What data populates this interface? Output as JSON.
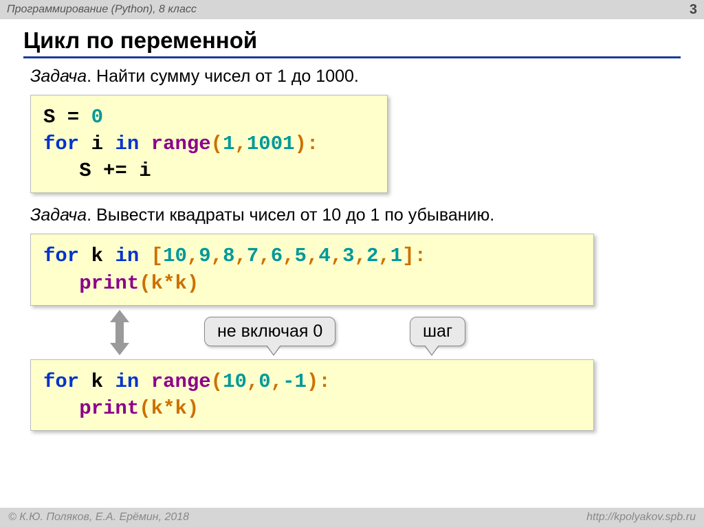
{
  "header": {
    "course": "Программирование (Python), 8 класс",
    "page": "3"
  },
  "title": "Цикл по переменной",
  "task1_label": "Задача",
  "task1_text": ". Найти сумму чисел от 1 до 1000.",
  "code1": {
    "l1a": "S = ",
    "l1b": "0",
    "l2a": "for",
    "l2b": " i ",
    "l2c": "in",
    "l2d": " range",
    "l2e": "(",
    "l2f": "1",
    "l2g": ",",
    "l2h": "1001",
    "l2i": "):",
    "l3": "   S += i"
  },
  "task2_label": "Задача",
  "task2_text": ". Вывести квадраты чисел от 10 до 1 по убыванию.",
  "code2": {
    "l1a": "for",
    "l1b": " k ",
    "l1c": "in",
    "l1d": " ",
    "l1e": "[",
    "l1f": "10",
    "l1g": ",",
    "l1h": "9",
    "l1i": ",",
    "l1j": "8",
    "l1k": ",",
    "l1l": "7",
    "l1m": ",",
    "l1n": "6",
    "l1o": ",",
    "l1p": "5",
    "l1q": ",",
    "l1r": "4",
    "l1s": ",",
    "l1t": "3",
    "l1u": ",",
    "l1v": "2",
    "l1w": ",",
    "l1x": "1",
    "l1y": "]:",
    "l2a": "   print",
    "l2b": "(k*k)"
  },
  "callout1": "не включая 0",
  "callout2": "шаг",
  "code3": {
    "l1a": "for",
    "l1b": " k ",
    "l1c": "in",
    "l1d": " range",
    "l1e": "(",
    "l1f": "10",
    "l1g": ",",
    "l1h": "0",
    "l1i": ",",
    "l1j": "-1",
    "l1k": "):",
    "l2a": "   print",
    "l2b": "(k*k)"
  },
  "footer": {
    "left": "© К.Ю. Поляков, Е.А. Ерёмин, 2018",
    "right": "http://kpolyakov.spb.ru"
  }
}
